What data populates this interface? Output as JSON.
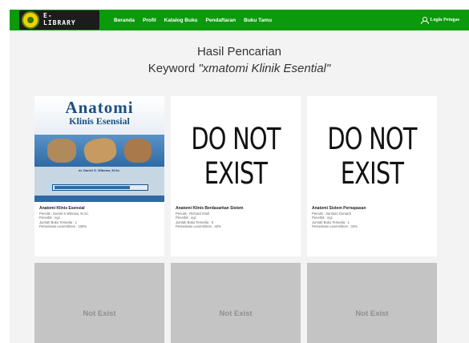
{
  "header": {
    "logo_text": "E-\nLIBRARY",
    "nav_items": [
      "Beranda",
      "Profil",
      "Katalog Buku",
      "Pendaftaran",
      "Buku Tamu"
    ],
    "login_label": "Login Petugas",
    "accent_color": "#0b9a0b"
  },
  "main": {
    "heading": "Hasil Pencarian",
    "keyword_prefix": "Keyword",
    "keyword_value": "\"xmatomi Klinik Esential\""
  },
  "results": [
    {
      "cover_title": "Anatomi",
      "cover_subtitle": "Klinis Esensial",
      "cover_author": "dr. Daniel S. Wibowo, M.Sc.",
      "title": "Anatomi Klinis Esensial",
      "penulis": "Penulis : Daniel S Wibowo, M.Sc.",
      "penerbit": "Penerbit : egc",
      "jumlah": "Jumlah Buku Tersedia : 1",
      "persentase": "Persentase Levenshtein : 100%"
    },
    {
      "image_text": "DO NOT EXIST",
      "title": "Anatomi Klinis Berdasarkan Sistem",
      "penulis": "Penulis : Richard Snell",
      "penerbit": "Penerbit : egc",
      "jumlah": "Jumlah Buku Tersedia : 8",
      "persentase": "Persentase Levenshtein : 40%"
    },
    {
      "image_text": "DO NOT EXIST",
      "title": "Anatomi Sistem Pernapasan",
      "penulis": "Penulis : Santoso Gunardi",
      "penerbit": "Penerbit : egc",
      "jumlah": "Jumlah Buku Tersedia : 1",
      "persentase": "Persentase Levenshtein : 33%"
    }
  ],
  "placeholders": [
    "Not Exist",
    "Not Exist",
    "Not Exist"
  ]
}
